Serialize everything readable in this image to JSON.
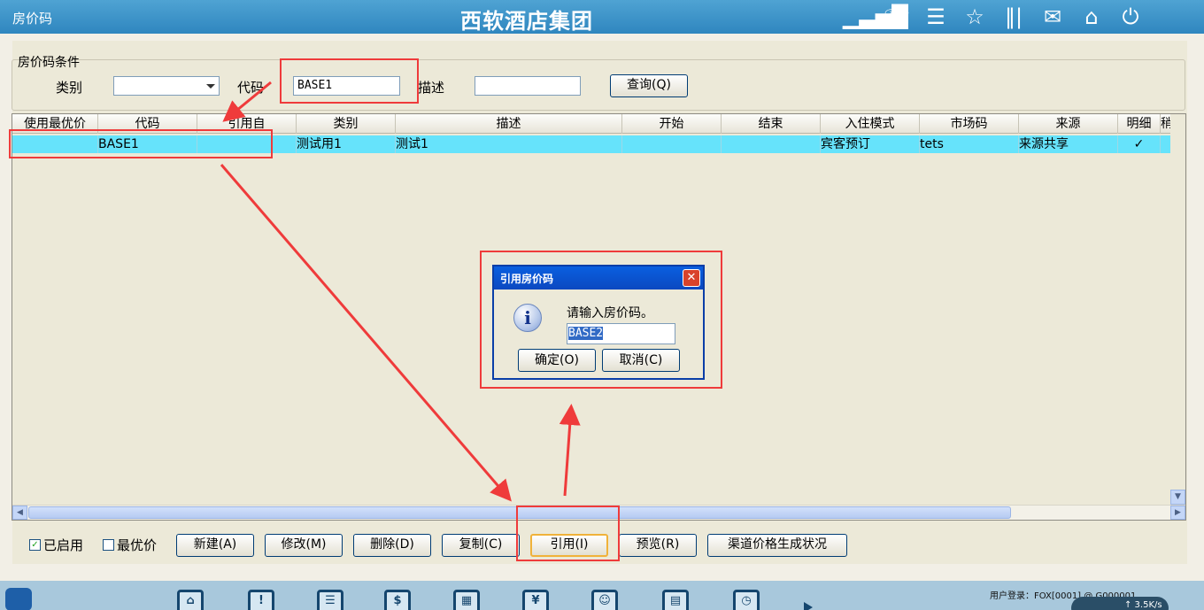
{
  "window": {
    "title": "房价码",
    "app_title": "西软酒店集团"
  },
  "top_icons": [
    "signal-icon",
    "phone-icon",
    "menu-icon",
    "star-icon",
    "columns-icon",
    "mail-icon",
    "home-icon",
    "power-icon"
  ],
  "criteria": {
    "legend": "房价码条件",
    "type_label": "类别",
    "type_value": "",
    "code_label": "代码",
    "code_value": "BASE1",
    "desc_label": "描述",
    "desc_value": "",
    "query_button": "查询(Q)"
  },
  "grid": {
    "columns": [
      "使用最优价",
      "代码",
      "引用自",
      "类别",
      "描述",
      "开始",
      "结束",
      "入住模式",
      "市场码",
      "来源",
      "明细",
      "稍"
    ],
    "rows": [
      {
        "use_best": "",
        "code": "BASE1",
        "ref_from": "",
        "category": "测试用1",
        "desc": "测试1",
        "start": "",
        "end": "",
        "mode": "宾客预订",
        "market": "tets",
        "source": "来源共享",
        "detail": "✓",
        "extra": ""
      }
    ]
  },
  "footer": {
    "enabled_label": "已启用",
    "enabled_checked": true,
    "best_price_label": "最优价",
    "best_price_checked": false,
    "buttons": {
      "new": "新建(A)",
      "modify": "修改(M)",
      "delete": "删除(D)",
      "copy": "复制(C)",
      "reference": "引用(I)",
      "preview": "预览(R)",
      "channel": "渠道价格生成状况"
    }
  },
  "dialog": {
    "title": "引用房价码",
    "prompt": "请输入房价码。",
    "input_value": "BASE2",
    "ok": "确定(O)",
    "cancel": "取消(C)",
    "close": "✕",
    "info_glyph": "i"
  },
  "taskbar": {
    "user_login": "用户登录：FOX[0001] @ G000001",
    "net_speed": "↑ 3.5K/s",
    "icon_glyphs": [
      "⌂",
      "!",
      "☰",
      "$",
      "▦",
      "¥",
      "☺",
      "▤",
      "◷"
    ]
  },
  "colors": {
    "title_bar": "#3a91c8",
    "selected_row": "#66e3fb",
    "annotation": "#ef3b3b",
    "dialog_title": "#0b52d0"
  }
}
